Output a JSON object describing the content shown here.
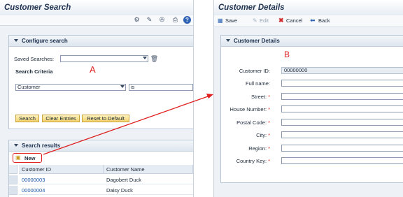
{
  "left": {
    "title": "Customer Search",
    "configure_search": {
      "header": "Configure search",
      "saved_searches_label": "Saved Searches:",
      "saved_searches_value": "",
      "search_criteria_label": "Search Criteria",
      "criterion_field": "Customer",
      "criterion_operator": "is",
      "buttons": {
        "search": "Search",
        "clear": "Clear Entries",
        "reset": "Reset to Default"
      }
    },
    "results": {
      "header": "Search results",
      "new_button": "New",
      "columns": [
        "Customer ID",
        "Customer Name"
      ],
      "rows": [
        {
          "id": "00000003",
          "name": "Dagobert Duck"
        },
        {
          "id": "00000004",
          "name": "Daisy Duck"
        }
      ]
    }
  },
  "right": {
    "title": "Customer Details",
    "toolbar": {
      "save": "Save",
      "edit": "Edit",
      "cancel": "Cancel",
      "back": "Back"
    },
    "section_header": "Customer Details",
    "fields": [
      {
        "label": "Customer ID:",
        "value": "00000000",
        "required": false,
        "readonly": true
      },
      {
        "label": "Full name:",
        "value": "",
        "required": false,
        "readonly": false
      },
      {
        "label": "Street:",
        "value": "",
        "required": true,
        "readonly": false
      },
      {
        "label": "House Number:",
        "value": "",
        "required": true,
        "readonly": false
      },
      {
        "label": "Postal Code:",
        "value": "",
        "required": true,
        "readonly": false
      },
      {
        "label": "City:",
        "value": "",
        "required": true,
        "readonly": false
      },
      {
        "label": "Region:",
        "value": "",
        "required": true,
        "readonly": false
      },
      {
        "label": "Country Key:",
        "value": "",
        "required": true,
        "readonly": false
      }
    ]
  },
  "annotations": {
    "marker_a": "A",
    "marker_b": "B",
    "required_mark": "*"
  },
  "colors": {
    "annotation": "#e01f1f",
    "link": "#1c57a8",
    "button_yellow": "#f3d26e",
    "header_text": "#1f3350"
  }
}
